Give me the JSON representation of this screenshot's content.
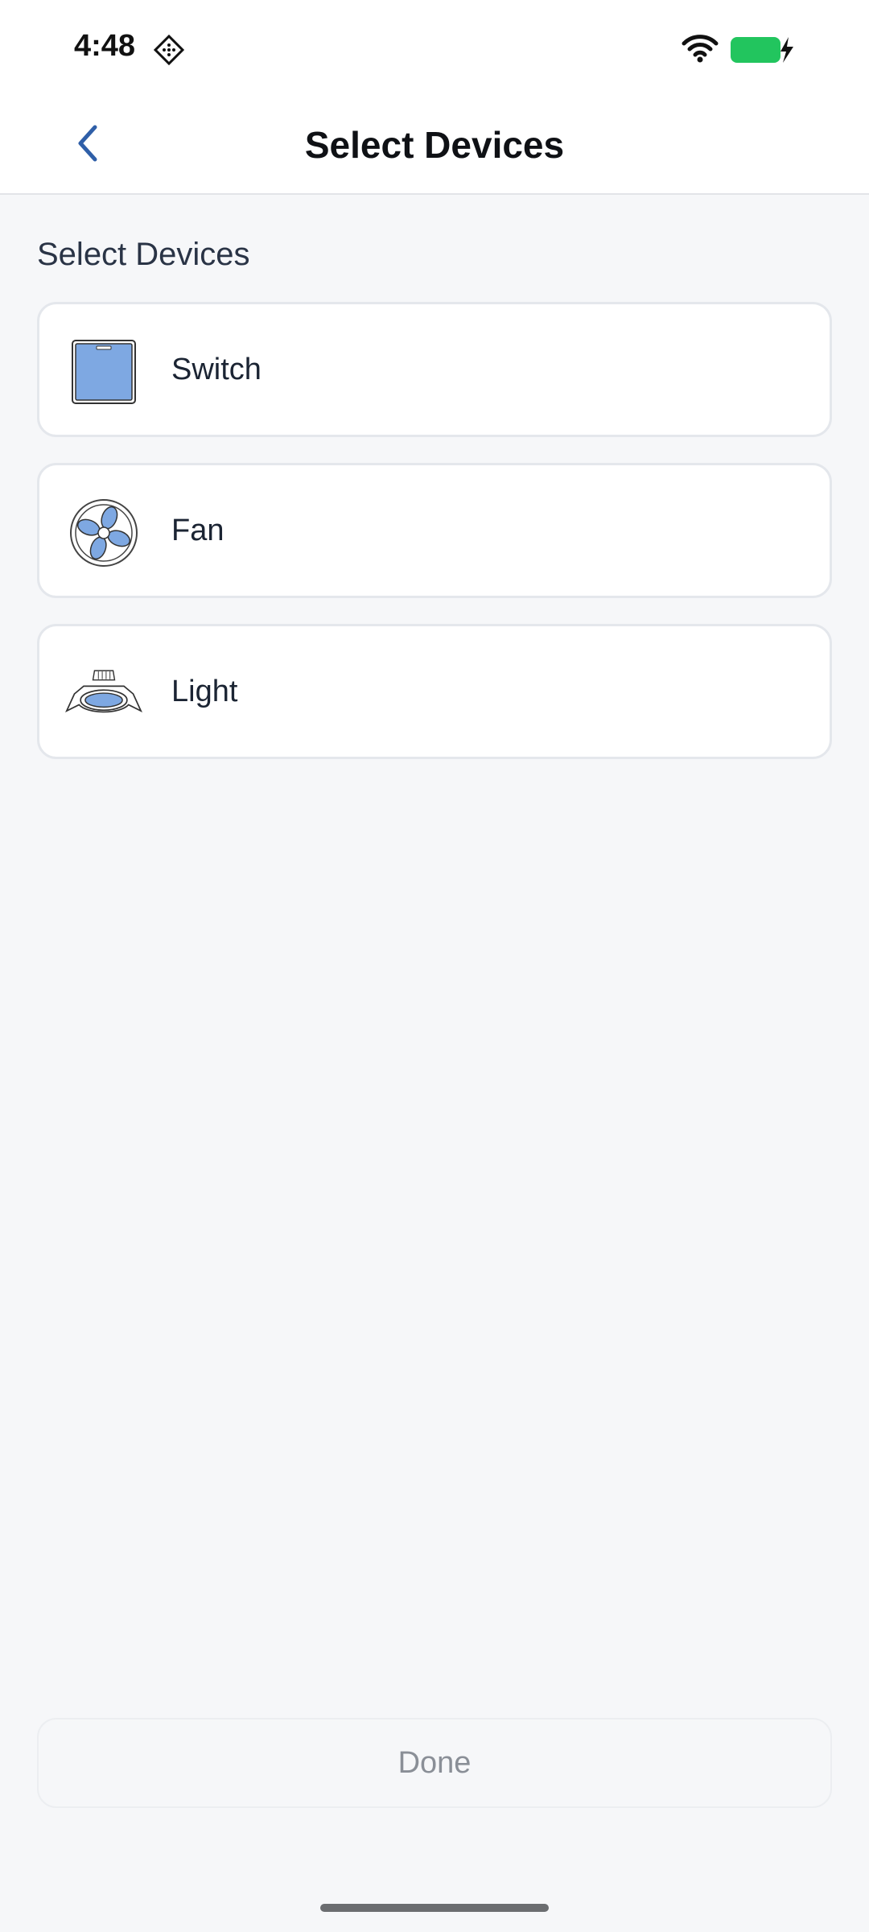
{
  "status_bar": {
    "time": "4:48",
    "nfc_icon": "nfc-diamond-icon",
    "wifi_icon": "wifi-icon",
    "battery_icon": "battery-charging-icon",
    "battery_color": "#22c55e"
  },
  "header": {
    "title": "Select Devices",
    "back_icon": "chevron-left-icon",
    "accent_color": "#2f5fa8"
  },
  "section": {
    "label": "Select Devices"
  },
  "devices": [
    {
      "name": "Switch",
      "icon": "switch-icon"
    },
    {
      "name": "Fan",
      "icon": "fan-icon"
    },
    {
      "name": "Light",
      "icon": "light-icon"
    }
  ],
  "footer": {
    "done_label": "Done"
  },
  "colors": {
    "icon_fill": "#7ea8e2",
    "background": "#f6f7f9"
  }
}
